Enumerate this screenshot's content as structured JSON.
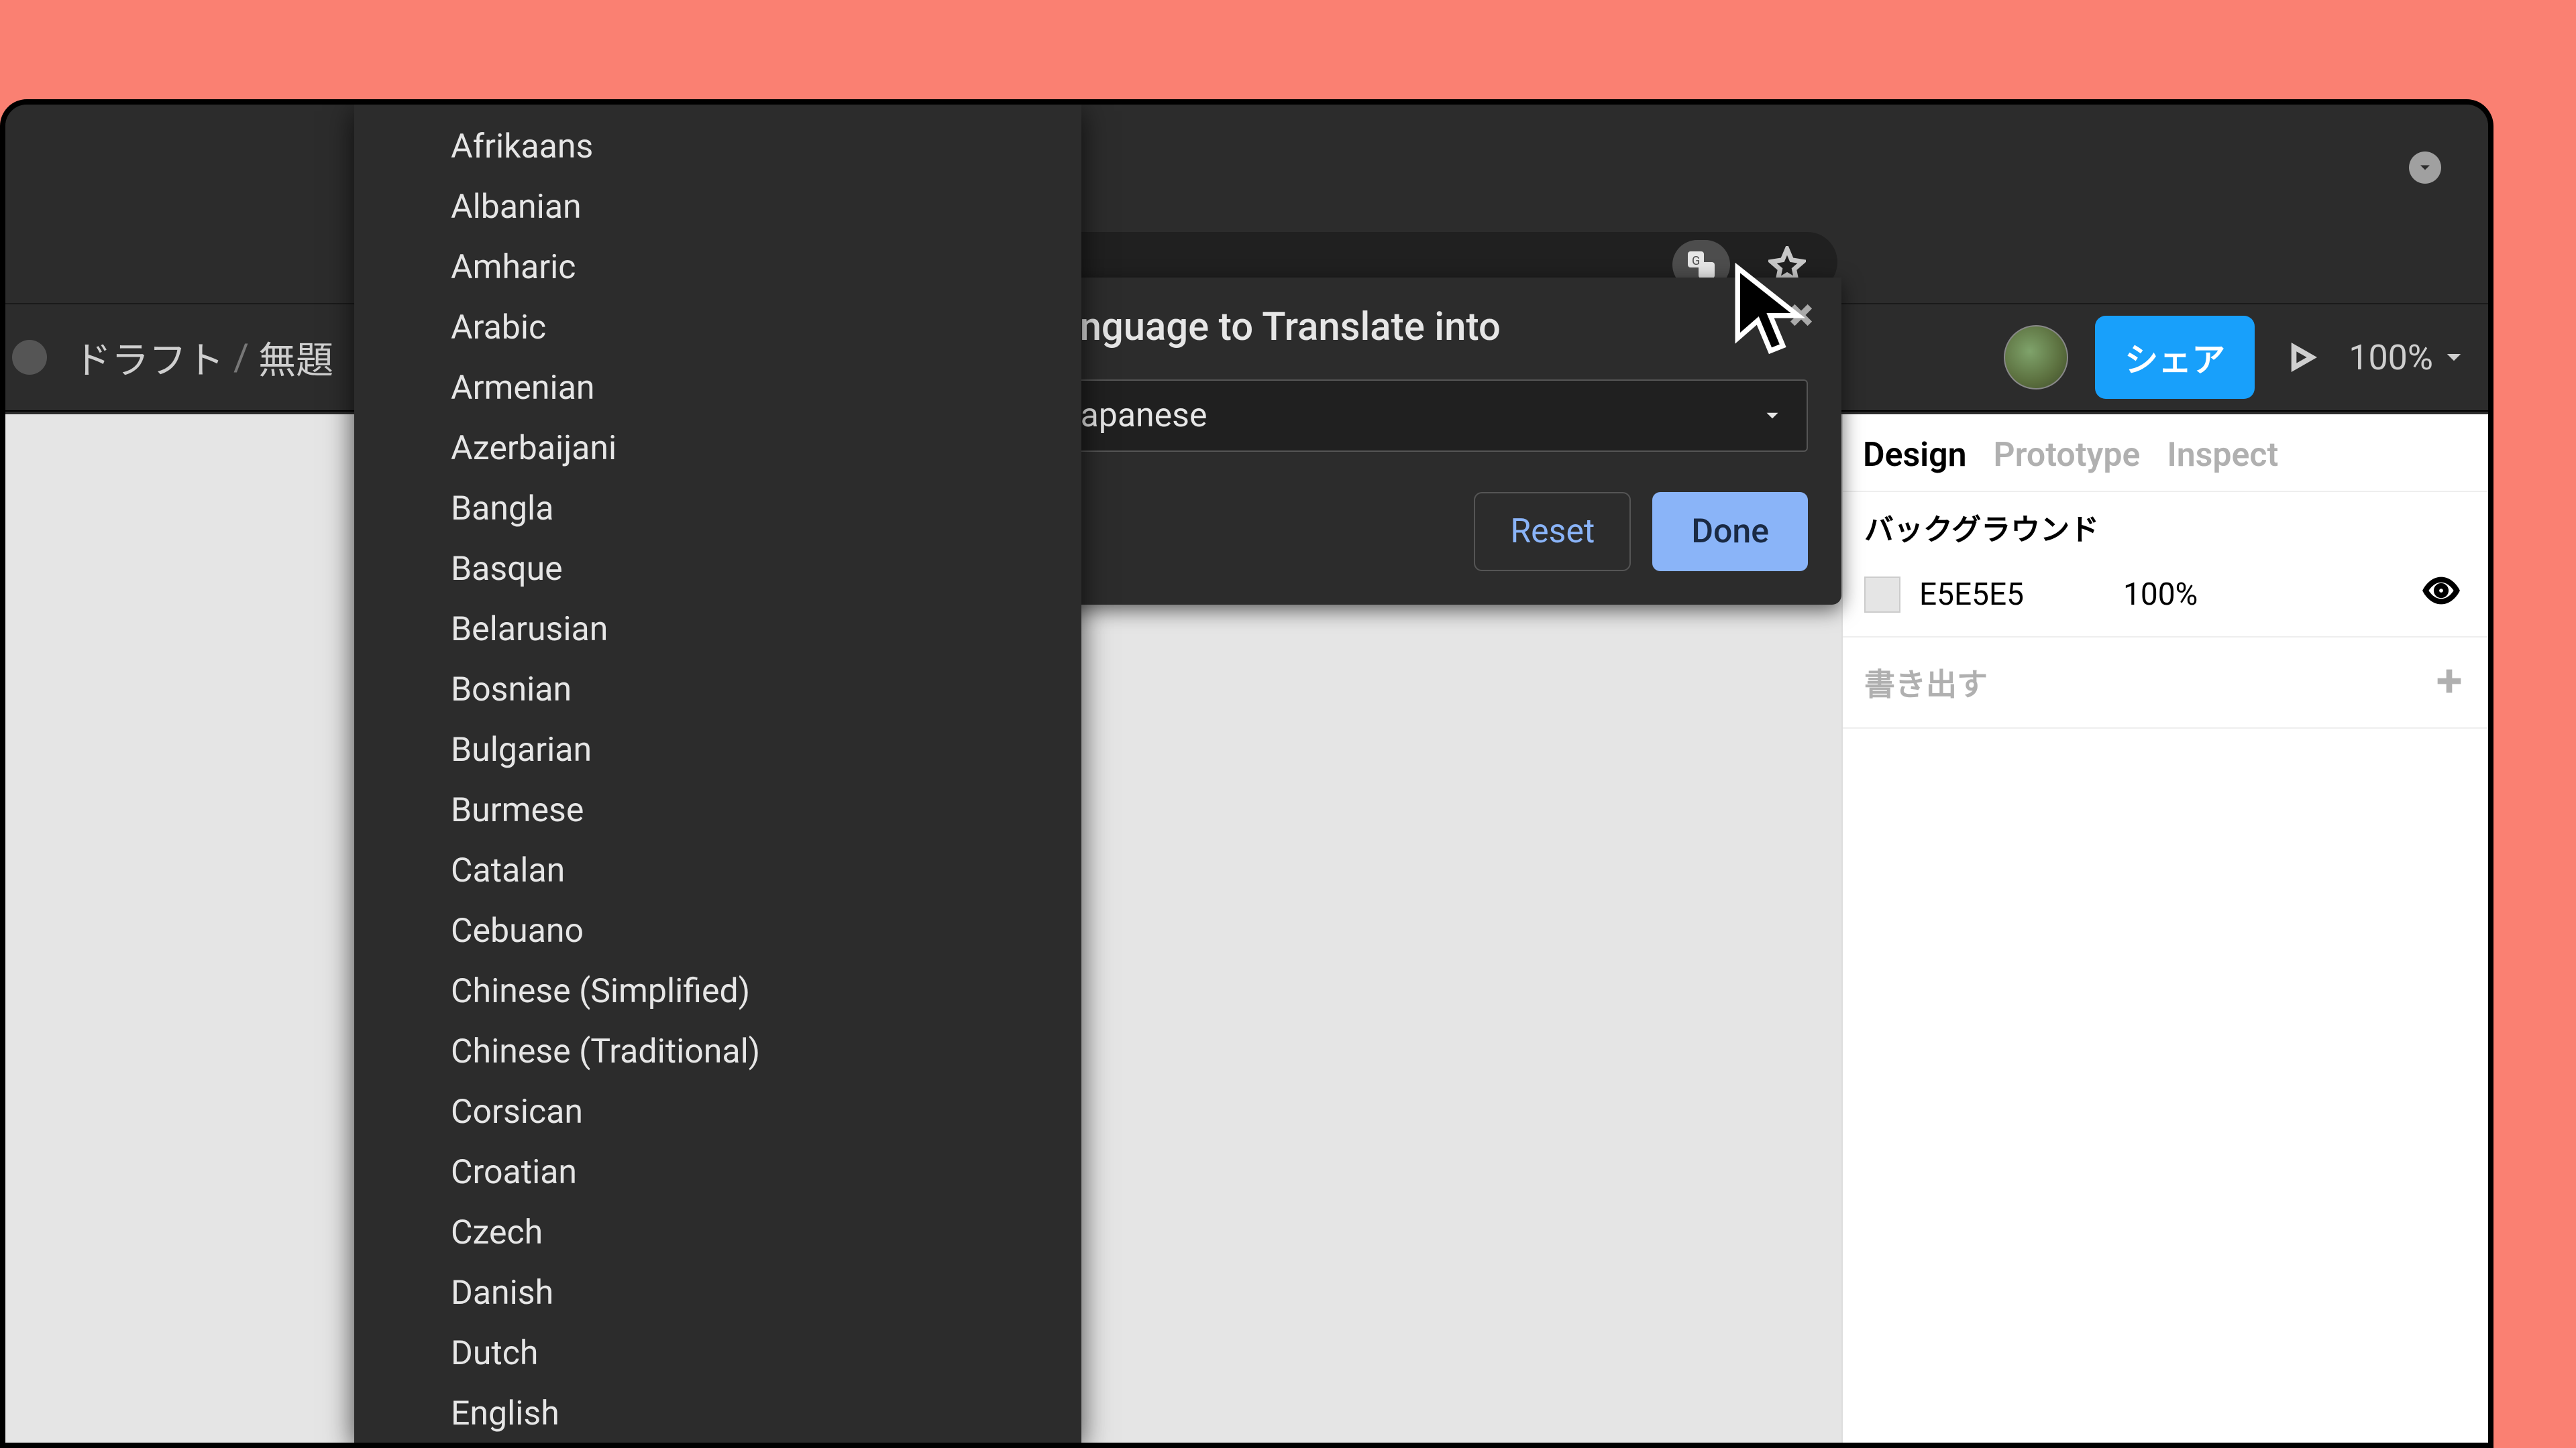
{
  "browser": {
    "translate_icon_label": "translate",
    "star_icon_label": "star"
  },
  "figma": {
    "breadcrumb_drafts": "ドラフト",
    "breadcrumb_sep": "/",
    "breadcrumb_file": "無題",
    "share_label": "シェア",
    "zoom_label": "100%"
  },
  "panel": {
    "tabs": {
      "design": "Design",
      "prototype": "Prototype",
      "inspect": "Inspect"
    },
    "background_label": "バックグラウンド",
    "background_hex": "E5E5E5",
    "background_opacity": "100%",
    "export_label": "書き出す"
  },
  "popover": {
    "title": "Language to Translate into",
    "selected_language": "Japanese",
    "reset_label": "Reset",
    "done_label": "Done"
  },
  "languages": [
    "Afrikaans",
    "Albanian",
    "Amharic",
    "Arabic",
    "Armenian",
    "Azerbaijani",
    "Bangla",
    "Basque",
    "Belarusian",
    "Bosnian",
    "Bulgarian",
    "Burmese",
    "Catalan",
    "Cebuano",
    "Chinese (Simplified)",
    "Chinese (Traditional)",
    "Corsican",
    "Croatian",
    "Czech",
    "Danish",
    "Dutch",
    "English"
  ]
}
